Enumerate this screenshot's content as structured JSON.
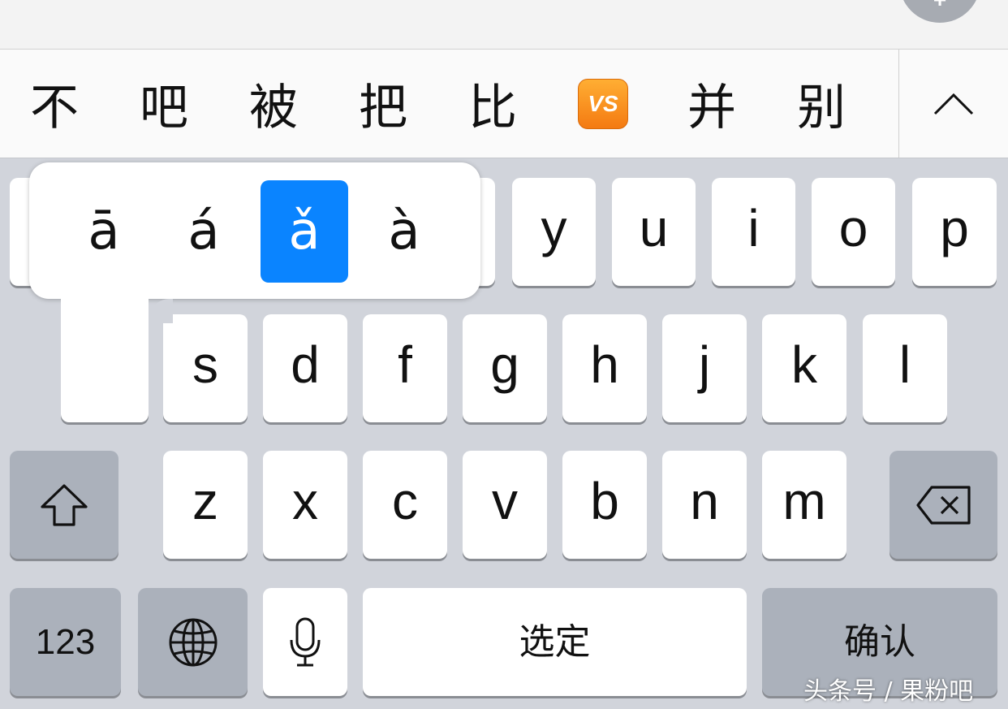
{
  "candidates": [
    "不",
    "吧",
    "被",
    "把",
    "比",
    "VS",
    "并",
    "别"
  ],
  "popup_accents": [
    "ā",
    "á",
    "ǎ",
    "à"
  ],
  "popup_selected": "ǎ",
  "row1": [
    "y",
    "u",
    "i",
    "o",
    "p"
  ],
  "row2": [
    "s",
    "d",
    "f",
    "g",
    "h",
    "j",
    "k",
    "l"
  ],
  "row3": [
    "z",
    "x",
    "c",
    "v",
    "b",
    "n",
    "m"
  ],
  "bottom": {
    "numbers_label": "123",
    "space_label": "选定",
    "return_label": "确认"
  },
  "watermark": "头条号 / 果粉吧",
  "colors": {
    "keyboard_bg": "#d1d4db",
    "key_white": "#ffffff",
    "key_gray": "#abb1bb",
    "accent_selected": "#0a84ff",
    "emoji_orange": "#f47a12"
  },
  "icons": [
    "chevron-up-icon",
    "shift-icon",
    "delete-icon",
    "globe-icon",
    "microphone-icon"
  ]
}
